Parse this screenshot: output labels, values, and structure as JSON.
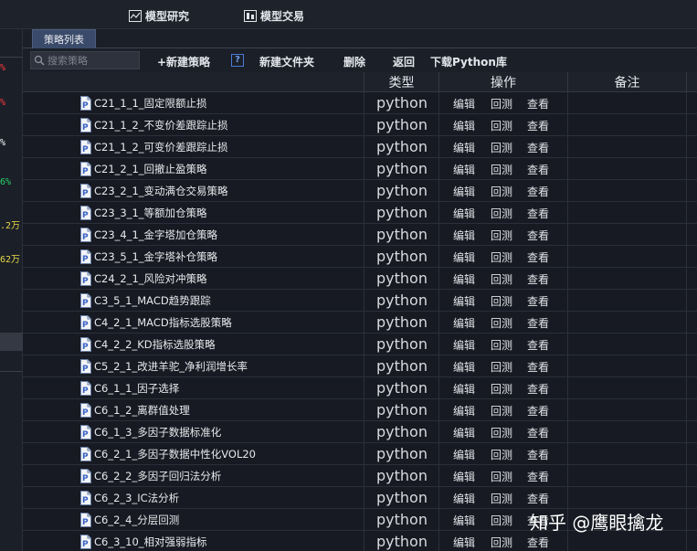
{
  "topbar": {
    "research_label": "模型研究",
    "trade_label": "模型交易"
  },
  "left_panel": {
    "values": [
      "%",
      "%",
      "%",
      "6%",
      ".2万",
      "62万"
    ],
    "colors": [
      "#ff3b3b",
      "#ff3b3b",
      "#ffffff",
      "#27d46b",
      "#e8d84a",
      "#e8d84a"
    ]
  },
  "tabs": [
    {
      "label": "策略列表"
    }
  ],
  "toolbar": {
    "search_placeholder": "搜索策略",
    "new_strategy": "+新建策略",
    "help": "?",
    "new_folder": "新建文件夹",
    "delete": "删除",
    "back": "返回",
    "download": "下载Python库"
  },
  "table": {
    "headers": {
      "type": "类型",
      "actions": "操作",
      "note": "备注"
    },
    "action_labels": {
      "edit": "编辑",
      "backtest": "回测",
      "view": "查看"
    },
    "rows": [
      {
        "name": "C21_1_1_固定限额止损",
        "type": "python"
      },
      {
        "name": "C21_1_2_不变价差跟踪止损",
        "type": "python"
      },
      {
        "name": "C21_1_2_可变价差跟踪止损",
        "type": "python"
      },
      {
        "name": "C21_2_1_回撤止盈策略",
        "type": "python"
      },
      {
        "name": "C23_2_1_变动满仓交易策略",
        "type": "python"
      },
      {
        "name": "C23_3_1_等额加仓策略",
        "type": "python"
      },
      {
        "name": "C23_4_1_金字塔加仓策略",
        "type": "python"
      },
      {
        "name": "C23_5_1_金字塔补仓策略",
        "type": "python"
      },
      {
        "name": "C24_2_1_风险对冲策略",
        "type": "python"
      },
      {
        "name": "C3_5_1_MACD趋势跟踪",
        "type": "python"
      },
      {
        "name": "C4_2_1_MACD指标选股策略",
        "type": "python"
      },
      {
        "name": "C4_2_2_KD指标选股策略",
        "type": "python"
      },
      {
        "name": "C5_2_1_改进羊驼_净利润增长率",
        "type": "python"
      },
      {
        "name": "C6_1_1_因子选择",
        "type": "python"
      },
      {
        "name": "C6_1_2_离群值处理",
        "type": "python"
      },
      {
        "name": "C6_1_3_多因子数据标准化",
        "type": "python"
      },
      {
        "name": "C6_2_1_多因子数据中性化VOL20",
        "type": "python"
      },
      {
        "name": "C6_2_2_多因子回归法分析",
        "type": "python"
      },
      {
        "name": "C6_2_3_IC法分析",
        "type": "python"
      },
      {
        "name": "C6_2_4_分层回测",
        "type": "python"
      },
      {
        "name": "C6_3_10_相对强弱指标",
        "type": "python"
      }
    ]
  },
  "watermark": "知乎 @鹰眼擒龙"
}
